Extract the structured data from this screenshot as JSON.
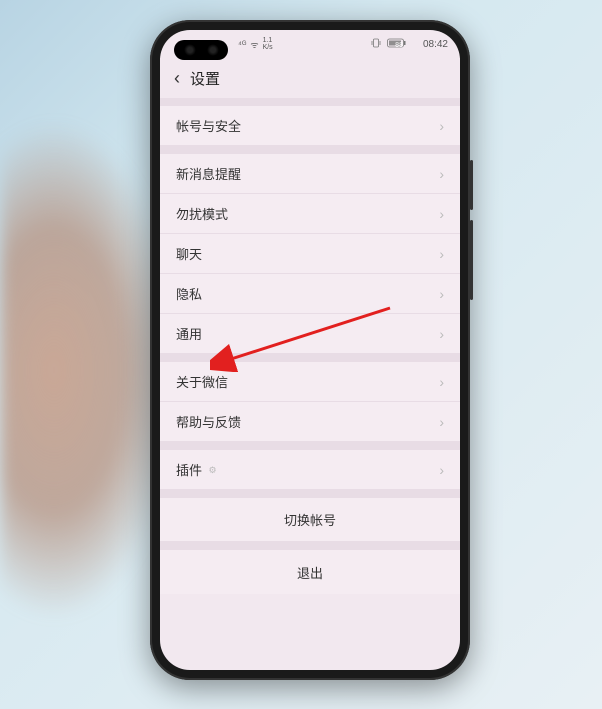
{
  "statusbar": {
    "signal": "⁴ᴳ",
    "wifi": "ᯤ",
    "speed_top": "1.1",
    "speed_bot": "K/s",
    "vibrate": "⬚",
    "battery_pct": "88",
    "time": "08:42"
  },
  "header": {
    "title": "设置"
  },
  "groups": [
    {
      "rows": [
        {
          "label": "帐号与安全"
        }
      ]
    },
    {
      "rows": [
        {
          "label": "新消息提醒"
        },
        {
          "label": "勿扰模式"
        },
        {
          "label": "聊天"
        },
        {
          "label": "隐私"
        },
        {
          "label": "通用"
        }
      ]
    },
    {
      "rows": [
        {
          "label": "关于微信"
        },
        {
          "label": "帮助与反馈"
        }
      ]
    },
    {
      "rows": [
        {
          "label": "插件",
          "has_gear": true
        }
      ]
    },
    {
      "center_rows": [
        {
          "label": "切换帐号"
        }
      ]
    },
    {
      "center_rows": [
        {
          "label": "退出"
        }
      ]
    }
  ]
}
